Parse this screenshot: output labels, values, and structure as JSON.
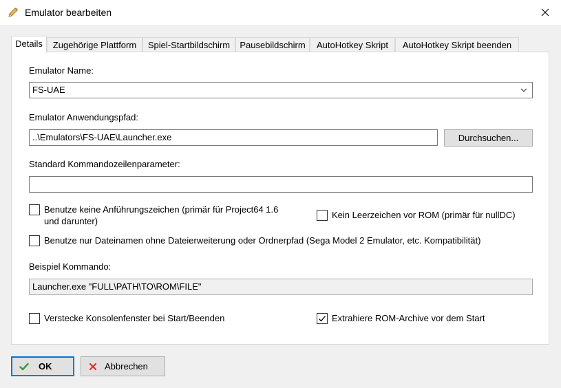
{
  "window": {
    "title": "Emulator bearbeiten"
  },
  "tabs": [
    {
      "label": "Details"
    },
    {
      "label": "Zugehörige Plattform"
    },
    {
      "label": "Spiel-Startbildschirm"
    },
    {
      "label": "Pausebildschirm"
    },
    {
      "label": "AutoHotkey Skript"
    },
    {
      "label": "AutoHotkey Skript beenden"
    }
  ],
  "form": {
    "name_label": "Emulator Name:",
    "name_value": "FS-UAE",
    "path_label": "Emulator Anwendungspfad:",
    "path_value": "..\\Emulators\\FS-UAE\\Launcher.exe",
    "browse_label": "Durchsuchen...",
    "params_label": "Standard Kommandozeilenparameter:",
    "params_value": "",
    "no_quotes_line1": "Benutze keine Anführungszeichen (primär für Project64 1.6",
    "no_quotes_line2": "und darunter)",
    "no_quotes_checked": false,
    "no_space_label": "Kein Leerzeichen vor ROM (primär für nullDC)",
    "no_space_checked": false,
    "filename_only_label": "Benutze nur Dateinamen ohne Dateierweiterung oder Ordnerpfad (Sega Model 2 Emulator, etc. Kompatibilität)",
    "filename_only_checked": false,
    "example_label": "Beispiel Kommando:",
    "example_value": "Launcher.exe \"FULL\\PATH\\TO\\ROM\\FILE\"",
    "hide_console_label": "Verstecke Konsolenfenster bei Start/Beenden",
    "hide_console_checked": false,
    "extract_label": "Extrahiere ROM-Archive vor dem Start",
    "extract_checked": true
  },
  "buttons": {
    "ok": "OK",
    "cancel": "Abbrechen"
  },
  "colors": {
    "ok_icon": "#2e9e3a",
    "cancel_icon": "#d9302c",
    "focus_border": "#0078d7"
  }
}
